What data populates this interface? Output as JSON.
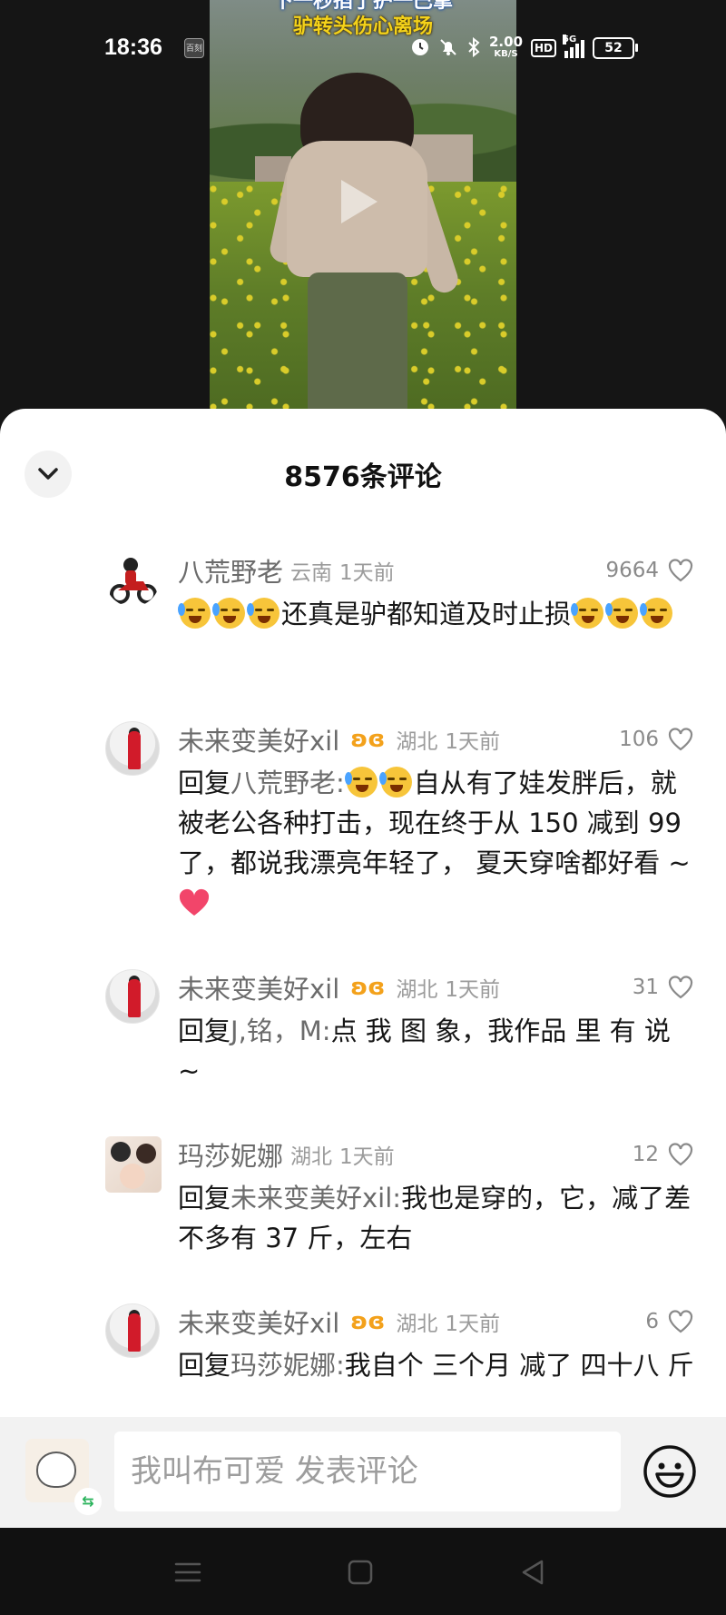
{
  "status_bar": {
    "time": "18:36",
    "app_badge": "百刻",
    "speed_value": "2.00",
    "speed_unit": "KB/S",
    "hd": "HD",
    "network": "5G",
    "battery": "52"
  },
  "video": {
    "caption_line1": "下一秒掐了护一巴掌",
    "caption_line2": "驴转头伤心离场"
  },
  "sheet": {
    "title": "8576条评论"
  },
  "comments": [
    {
      "user": "八荒野老",
      "location": "云南",
      "time": "1天前",
      "likes": "9664",
      "text_a": "还真是驴都知道及时止损"
    },
    {
      "user": "未来变美好xil",
      "location": "湖北",
      "time": "1天前",
      "likes": "106",
      "reply_prefix": "回复",
      "reply_to": "八荒野老:",
      "text": "自从有了娃发胖后，就被老公各种打击，现在终于从 150 减到 99 了，都说我漂亮年轻了， 夏天穿啥都好看 ~"
    },
    {
      "user": "未来变美好xil",
      "location": "湖北",
      "time": "1天前",
      "likes": "31",
      "reply_prefix": "回复",
      "reply_to": "J,铭，M:",
      "text": "点 我 图 象，我作品 里 有 说 ~"
    },
    {
      "user": "玛莎妮娜",
      "location": "湖北",
      "time": "1天前",
      "likes": "12",
      "reply_prefix": "回复",
      "reply_to": "未来变美好xil:",
      "text": "我也是穿的，它，减了差不多有 37 斤，左右"
    },
    {
      "user": "未来变美好xil",
      "location": "湖北",
      "time": "1天前",
      "likes": "6",
      "reply_prefix": "回复",
      "reply_to": "玛莎妮娜:",
      "text": "我自个 三个月 减了 四十八 斤"
    }
  ],
  "input": {
    "placeholder": "我叫布可爱 发表评论"
  }
}
